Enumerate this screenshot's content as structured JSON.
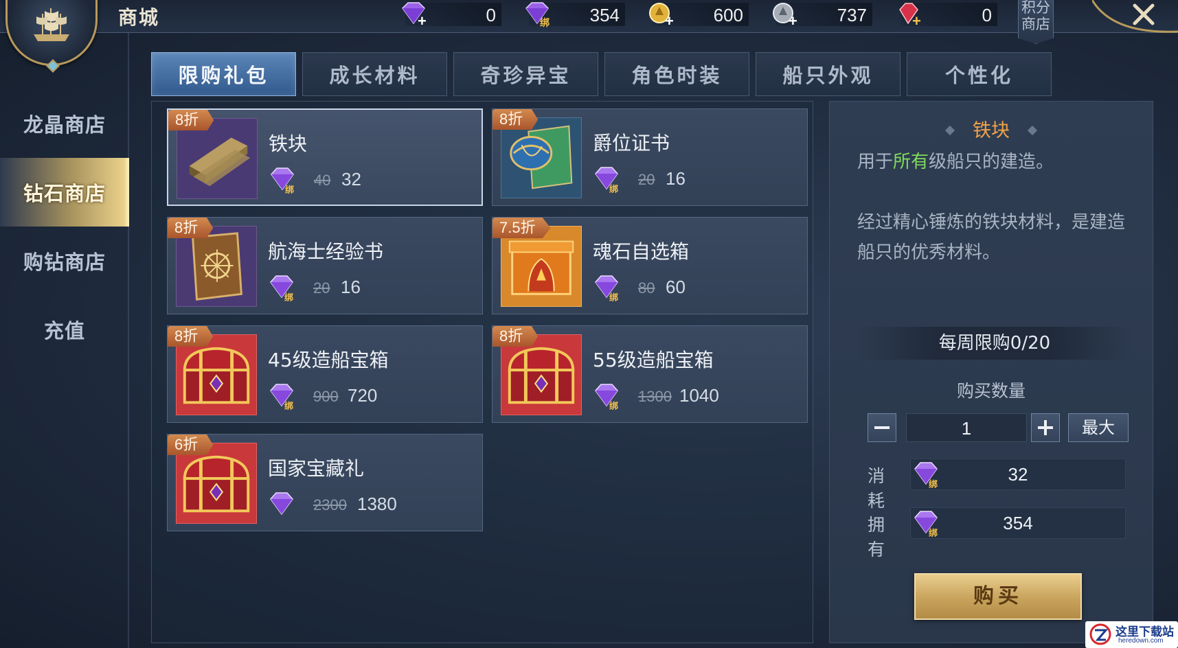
{
  "header": {
    "title": "商城",
    "currencies": [
      {
        "icon": "purple-gem-icon",
        "value": "0"
      },
      {
        "icon": "bound-purple-gem-icon",
        "bound_label": "绑",
        "value": "354"
      },
      {
        "icon": "gold-coin-icon",
        "value": "600"
      },
      {
        "icon": "silver-coin-icon",
        "value": "737"
      },
      {
        "icon": "red-gem-icon",
        "value": "0"
      }
    ],
    "points_shop_label": "积分商店",
    "close_icon": "close-icon"
  },
  "sidebar": {
    "items": [
      {
        "label": "龙晶商店",
        "active": false
      },
      {
        "label": "钻石商店",
        "active": true
      },
      {
        "label": "购钻商店",
        "active": false
      },
      {
        "label": "充值",
        "active": false
      }
    ]
  },
  "tabs": [
    {
      "label": "限购礼包",
      "active": true
    },
    {
      "label": "成长材料",
      "active": false
    },
    {
      "label": "奇珍异宝",
      "active": false
    },
    {
      "label": "角色时装",
      "active": false
    },
    {
      "label": "船只外观",
      "active": false
    },
    {
      "label": "个性化",
      "active": false
    }
  ],
  "items": [
    {
      "badge": "8折",
      "name": "铁块",
      "old_price": "40",
      "price": "32",
      "bound": true,
      "selected": true,
      "icon": "iron-ingot-icon"
    },
    {
      "badge": "8折",
      "name": "爵位证书",
      "old_price": "20",
      "price": "16",
      "bound": true,
      "selected": false,
      "icon": "title-certificate-icon"
    },
    {
      "badge": "8折",
      "name": "航海士经验书",
      "old_price": "20",
      "price": "16",
      "bound": true,
      "selected": false,
      "icon": "experience-book-icon"
    },
    {
      "badge": "7.5折",
      "name": "魂石自选箱",
      "old_price": "80",
      "price": "60",
      "bound": true,
      "selected": false,
      "icon": "soulstone-box-icon"
    },
    {
      "badge": "8折",
      "name": "45级造船宝箱",
      "old_price": "900",
      "price": "720",
      "bound": true,
      "selected": false,
      "icon": "treasure-chest-icon"
    },
    {
      "badge": "8折",
      "name": "55级造船宝箱",
      "old_price": "1300",
      "price": "1040",
      "bound": true,
      "selected": false,
      "icon": "treasure-chest-icon"
    },
    {
      "badge": "6折",
      "name": "国家宝藏礼",
      "old_price": "2300",
      "price": "1380",
      "bound": false,
      "selected": false,
      "icon": "treasure-chest-icon"
    }
  ],
  "detail": {
    "title": "铁块",
    "desc1_pre": "用于",
    "desc1_highlight": "所有",
    "desc1_post": "级船只的建造。",
    "desc2": "经过精心锤炼的铁块材料，是建造船只的优秀材料。",
    "weekly_limit": "每周限购0/20",
    "qty_label": "购买数量",
    "qty_value": "1",
    "minus_icon": "minus-icon",
    "plus_icon": "plus-icon",
    "max_label": "最大",
    "cost_label": "消耗",
    "cost_value": "32",
    "own_label": "拥有",
    "own_value": "354",
    "buy_label": "购买"
  },
  "bound_label": "绑",
  "watermark": {
    "cn": "这里下载站",
    "en": "heredown.com"
  },
  "colors": {
    "accent_orange": "#f2a247",
    "highlight_green": "#7fdc5a",
    "active_tab": "#4a76a8",
    "buy_gold": "#c8a35c"
  }
}
